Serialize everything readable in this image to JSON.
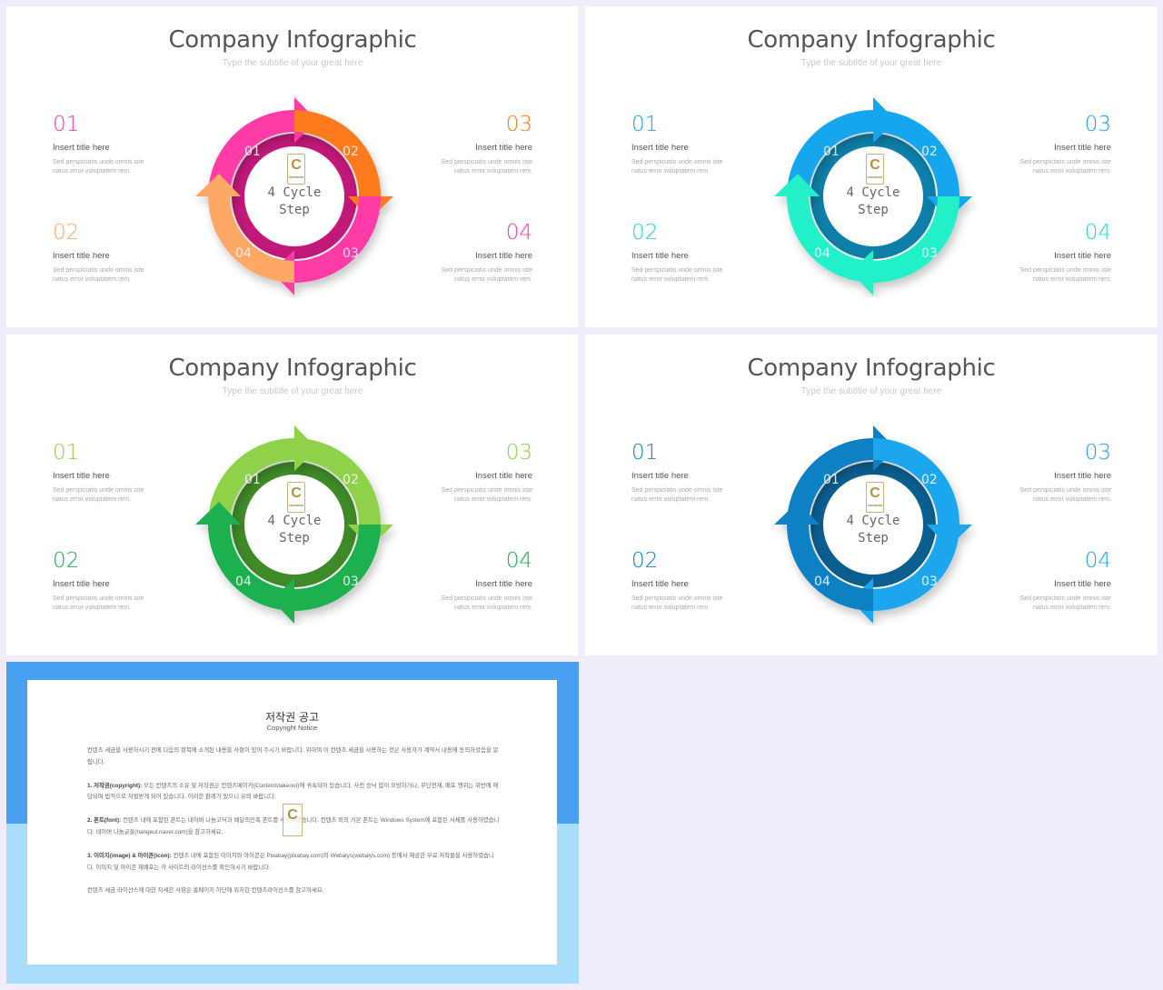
{
  "slides": [
    {
      "title": "Company Infographic",
      "subtitle": "Type the subtitle of your great here",
      "center_text_1": "4 Cycle",
      "center_text_2": "Step",
      "colors": {
        "s1": "#ff3aa8",
        "s2": "#ff7a1a",
        "s3": "#ff3aa8",
        "s4": "#ffa866",
        "ring": "#c2187a"
      },
      "items": [
        {
          "num": "01",
          "title": "Insert title here",
          "desc1": "Sed perspiciatis unde omnis iste",
          "desc2": "natus error voluptatem rem.",
          "color": "#ff3aa8"
        },
        {
          "num": "02",
          "title": "Insert title here",
          "desc1": "Sed perspiciatis unde omnis iste",
          "desc2": "natus error voluptatem rem.",
          "color": "#ffa866"
        },
        {
          "num": "03",
          "title": "Insert title here",
          "desc1": "Sed perspiciatis unde omnis iste",
          "desc2": "natus error voluptatem rem.",
          "color": "#ff7a1a"
        },
        {
          "num": "04",
          "title": "Insert title here",
          "desc1": "Sed perspiciatis unde omnis iste",
          "desc2": "natus error voluptatem rem.",
          "color": "#ff3aa8"
        }
      ],
      "seg_labels": [
        "01",
        "02",
        "03",
        "04"
      ]
    },
    {
      "title": "Company Infographic",
      "subtitle": "Type the subtitle of your great here",
      "center_text_1": "4 Cycle",
      "center_text_2": "Step",
      "colors": {
        "s1": "#19a6ee",
        "s2": "#19a6ee",
        "s3": "#22f0c8",
        "s4": "#22f0c8",
        "ring": "#0d7fa8"
      },
      "items": [
        {
          "num": "01",
          "title": "Insert title here",
          "desc1": "Sed perspiciatis unde omnis iste",
          "desc2": "natus error voluptatem rem.",
          "color": "#19a6ee"
        },
        {
          "num": "02",
          "title": "Insert title here",
          "desc1": "Sed perspiciatis unde omnis iste",
          "desc2": "natus error voluptatem rem.",
          "color": "#22e0c0"
        },
        {
          "num": "03",
          "title": "Insert title here",
          "desc1": "Sed perspiciatis unde omnis iste",
          "desc2": "natus error voluptatem rem.",
          "color": "#19a6ee"
        },
        {
          "num": "04",
          "title": "Insert title here",
          "desc1": "Sed perspiciatis unde omnis iste",
          "desc2": "natus error voluptatem rem.",
          "color": "#22e0c0"
        }
      ],
      "seg_labels": [
        "01",
        "02",
        "03",
        "04"
      ]
    },
    {
      "title": "Company Infographic",
      "subtitle": "Type the subtitle of your great here",
      "center_text_1": "4 Cycle",
      "center_text_2": "Step",
      "colors": {
        "s1": "#8fd24a",
        "s2": "#8fd24a",
        "s3": "#1cb050",
        "s4": "#1cb050",
        "ring": "#3f8a28"
      },
      "items": [
        {
          "num": "01",
          "title": "Insert title here",
          "desc1": "Sed perspiciatis unde omnis iste",
          "desc2": "natus error voluptatem rem.",
          "color": "#8fd24a"
        },
        {
          "num": "02",
          "title": "Insert title here",
          "desc1": "Sed perspiciatis unde omnis iste",
          "desc2": "natus error voluptatem rem.",
          "color": "#1cb050"
        },
        {
          "num": "03",
          "title": "Insert title here",
          "desc1": "Sed perspiciatis unde omnis iste",
          "desc2": "natus error voluptatem rem.",
          "color": "#8fd24a"
        },
        {
          "num": "04",
          "title": "Insert title here",
          "desc1": "Sed perspiciatis unde omnis iste",
          "desc2": "natus error voluptatem rem.",
          "color": "#1cb050"
        }
      ],
      "seg_labels": [
        "01",
        "02",
        "03",
        "04"
      ]
    },
    {
      "title": "Company Infographic",
      "subtitle": "Type the subtitle of your great here",
      "center_text_1": "4 Cycle",
      "center_text_2": "Step",
      "colors": {
        "s1": "#1181c4",
        "s2": "#1aa6ee",
        "s3": "#1aa6ee",
        "s4": "#1181c4",
        "ring": "#0b5e90"
      },
      "items": [
        {
          "num": "01",
          "title": "Insert title here",
          "desc1": "Sed perspiciatis unde omnis iste",
          "desc2": "natus error voluptatem rem.",
          "color": "#1181c4"
        },
        {
          "num": "02",
          "title": "Insert title here",
          "desc1": "Sed perspiciatis unde omnis iste",
          "desc2": "natus error voluptatem rem.",
          "color": "#1181c4"
        },
        {
          "num": "03",
          "title": "Insert title here",
          "desc1": "Sed perspiciatis unde omnis iste",
          "desc2": "natus error voluptatem rem.",
          "color": "#1aa6ee"
        },
        {
          "num": "04",
          "title": "Insert title here",
          "desc1": "Sed perspiciatis unde omnis iste",
          "desc2": "natus error voluptatem rem.",
          "color": "#1aa6ee"
        }
      ],
      "seg_labels": [
        "01",
        "02",
        "03",
        "04"
      ]
    }
  ],
  "logo": {
    "letter": "C",
    "caption": "CONTENTS"
  },
  "copyright": {
    "title": "저작권 공고",
    "subtitle": "Copyright Notice",
    "p1": "컨텐츠 세금을 사용하시기 전에 다음의 항목에 소개된 내용을 사항이 있어 주시기 바랍니다. 위하여 이 컨텐츠 세금을 사용하는 것은 사용자가 계약서 내용에 동의하셨음을 알립니다.",
    "p2_head": "1. 저작권(copyright):",
    "p2": " 모든 컨텐츠의 소유 및 저작권은 컨텐츠메이커(Contentstakeout)에 귀속되어 있습니다. 사전 승낙 없이 모방하거나, 무단전재, 배포 행위는 위반에 해당되며 법적으로 처벌받게 되어 있습니다. 이러한 판례가 있으니 유의 바랍니다.",
    "p3_head": "2. 폰트(font):",
    "p3": " 컨텐츠 내에 포함된 폰트는 네이버 나눔고딕과 배달의민족 폰트를 사용하였습니다. 컨텐츠 외의 기본 폰트는 Windows System에 포함된 서체를 사용하였습니다. 네이버 나눔글꼴(hangeul.naver.com)을 참고하세요.",
    "p4_head": "3. 이미지(image) & 아이콘(icon):",
    "p4": " 컨텐츠 내에 포함된 이미지와 아이콘은 Pixabay(pixabay.com)와 Webalys(webalys.com) 등에서 제공한 무료 저작물을 사용하였습니다. 이미지 및 아이콘 재배포는 각 사이트의 라이선스를 확인하시기 바랍니다.",
    "p5": "컨텐츠 세금 라이선스에 대한 자세한 사항은 홈페이지 하단에 위치한 컨텐츠라이선스를 참고하세요."
  }
}
